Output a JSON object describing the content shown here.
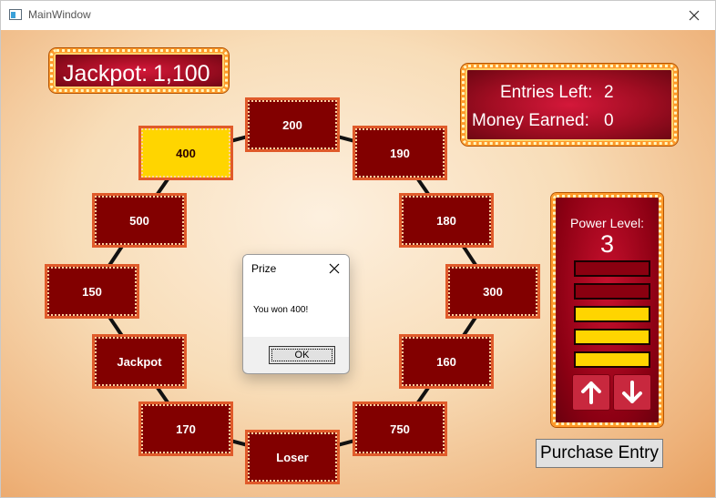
{
  "window": {
    "title": "MainWindow",
    "icon": "window-app-icon",
    "close_icon": "close-icon"
  },
  "jackpot": {
    "label": "Jackpot:",
    "value": "1,100"
  },
  "stats": {
    "entries_left_label": "Entries Left:",
    "entries_left_value": "2",
    "money_earned_label": "Money Earned:",
    "money_earned_value": "0"
  },
  "wheel": {
    "tiles": [
      {
        "label": "200",
        "selected": false
      },
      {
        "label": "190",
        "selected": false
      },
      {
        "label": "180",
        "selected": false
      },
      {
        "label": "300",
        "selected": false
      },
      {
        "label": "160",
        "selected": false
      },
      {
        "label": "750",
        "selected": false
      },
      {
        "label": "Loser",
        "selected": false
      },
      {
        "label": "170",
        "selected": false
      },
      {
        "label": "Jackpot",
        "selected": false
      },
      {
        "label": "150",
        "selected": false
      },
      {
        "label": "500",
        "selected": false
      },
      {
        "label": "400",
        "selected": true
      }
    ],
    "colors": {
      "tile": "#820000",
      "selected": "#ffd500",
      "border": "#e05a2a"
    }
  },
  "power": {
    "label": "Power Level:",
    "value": "3",
    "level": 3,
    "max": 5,
    "colors": {
      "on": "#ffd500",
      "off": "#8a0010"
    },
    "up_icon": "arrow-up-icon",
    "down_icon": "arrow-down-icon"
  },
  "purchase_button": "Purchase Entry",
  "dialog": {
    "title": "Prize",
    "message": "You won 400!",
    "ok_label": "OK",
    "close_icon": "close-icon"
  }
}
